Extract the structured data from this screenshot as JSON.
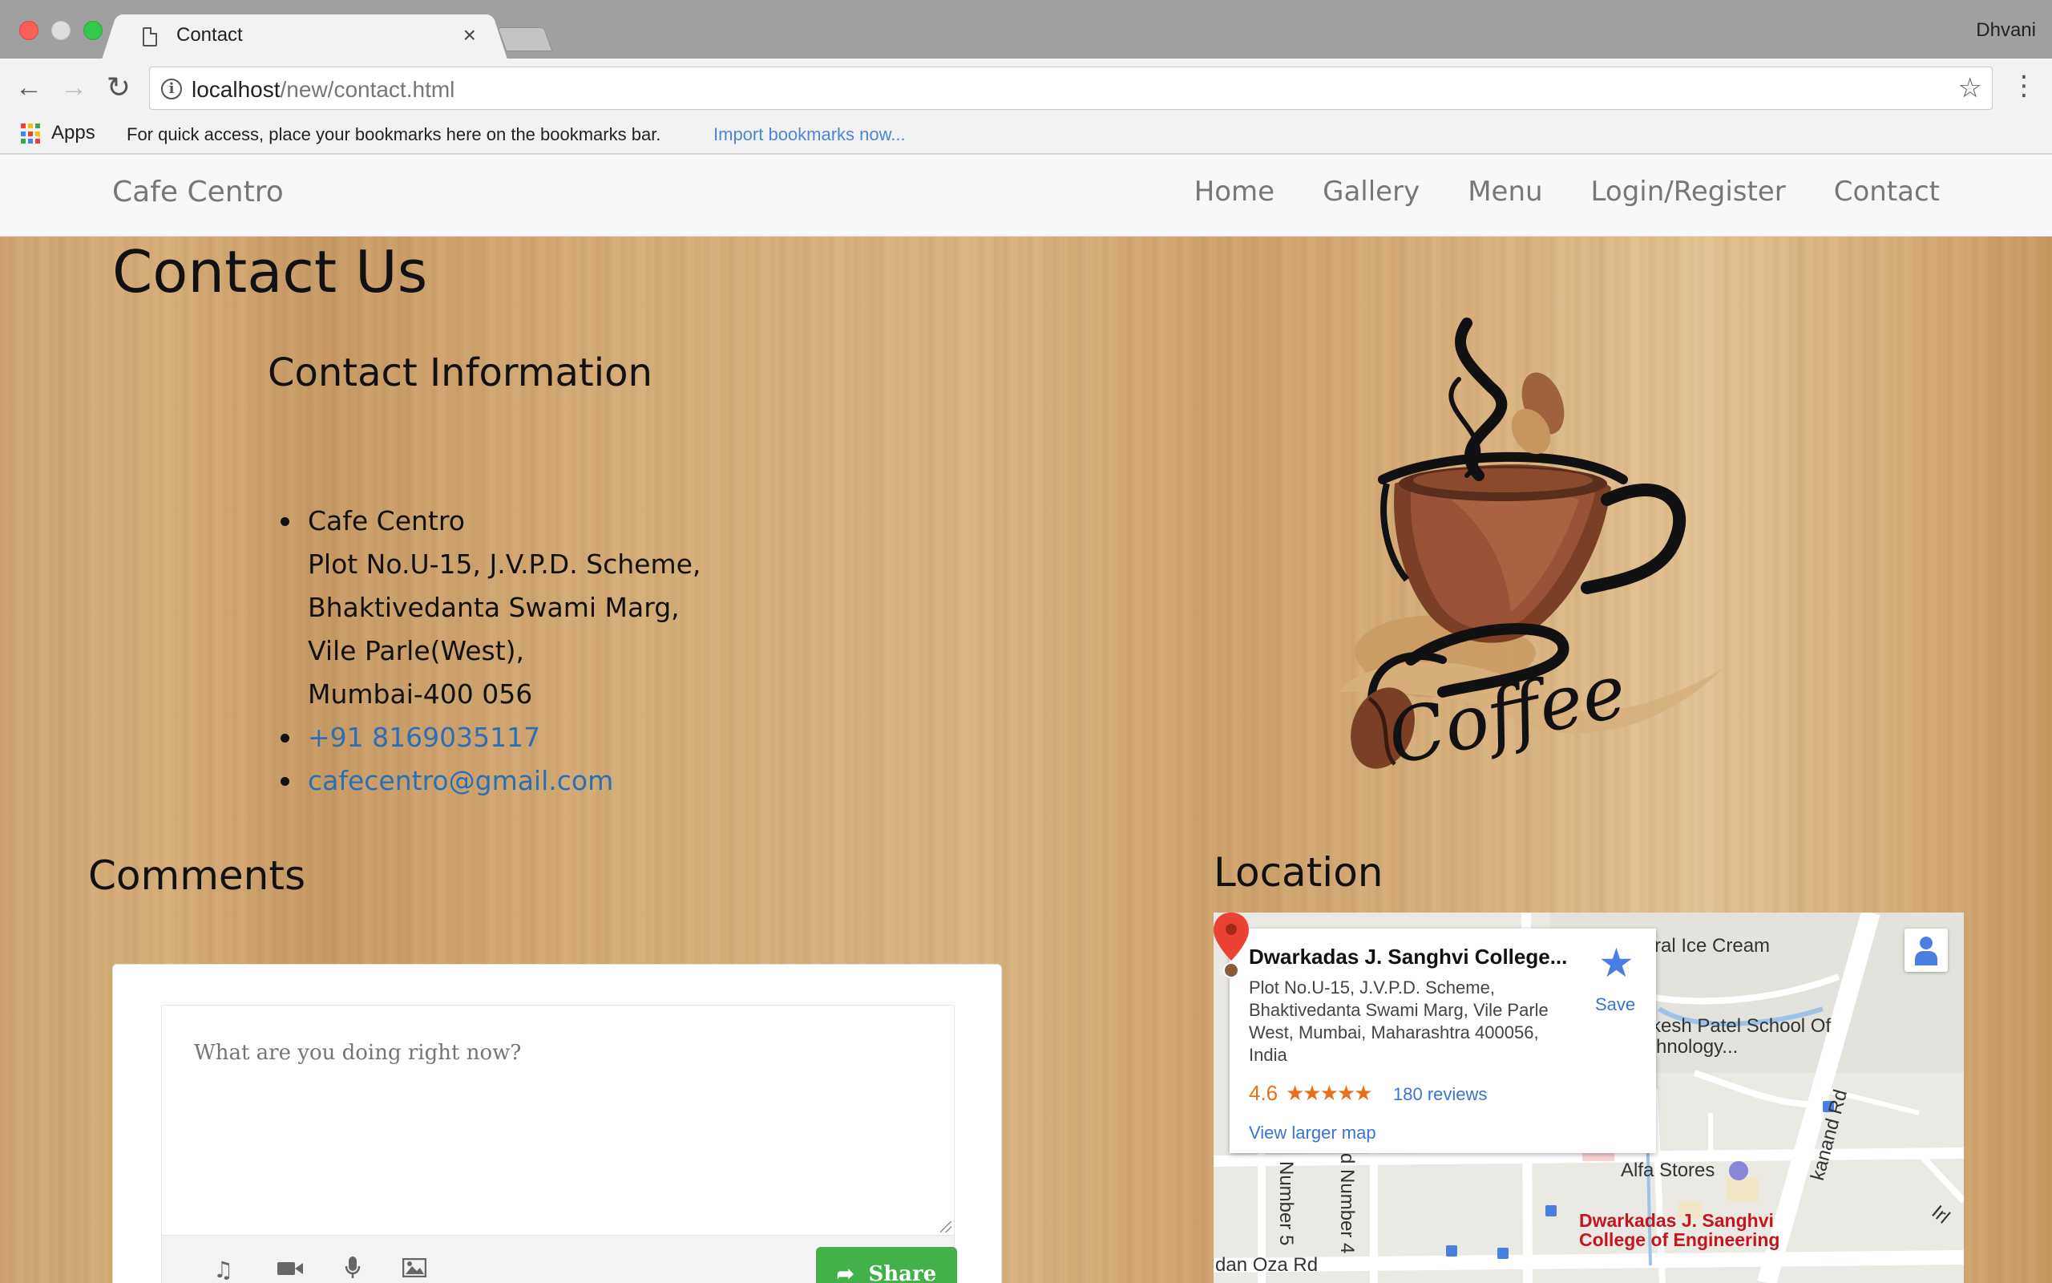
{
  "browser": {
    "tab_title": "Contact",
    "tab_close": "×",
    "profile_name": "Dhvani",
    "url_host": "localhost",
    "url_path": "/new/contact.html",
    "bookmarks": {
      "apps_label": "Apps",
      "hint": "For quick access, place your bookmarks here on the bookmarks bar.",
      "import_link": "Import bookmarks now..."
    }
  },
  "site": {
    "brand": "Cafe Centro",
    "nav": [
      "Home",
      "Gallery",
      "Menu",
      "Login/Register",
      "Contact"
    ]
  },
  "contact": {
    "heading": "Contact Us",
    "info_heading": "Contact Information",
    "address_lines": [
      "Cafe Centro",
      "Plot No.U-15, J.V.P.D. Scheme,",
      "Bhaktivedanta Swami Marg,",
      "Vile Parle(West),",
      "Mumbai-400 056"
    ],
    "phone": "+91 8169035117",
    "email": "cafecentro@gmail.com",
    "logo_text": "Coffee"
  },
  "comments": {
    "heading": "Comments",
    "placeholder": "What are you doing right now?",
    "share_label": "Share",
    "tools": [
      "music-icon",
      "video-icon",
      "mic-icon",
      "image-icon"
    ]
  },
  "location": {
    "heading": "Location",
    "card": {
      "name": "Dwarkadas J. Sanghvi College...",
      "address": "Plot No.U-15, J.V.P.D. Scheme, Bhaktivedanta Swami Marg, Vile Parle West, Mumbai, Maharashtra 400056, India",
      "rating": "4.6",
      "stars": "★★★★★",
      "reviews": "180 reviews",
      "larger_map": "View larger map",
      "save_label": "Save"
    },
    "map_labels": {
      "ice_cream": "ral Ice Cream",
      "school_1": "kesh Patel School Of",
      "school_2": "hnology...",
      "alfa": "Alfa Stores",
      "road_1": "Number 5",
      "road_2": "d Number 4",
      "road_3": "kanand Rd",
      "road_4": "dan Oza Rd",
      "road_5": "Irl",
      "pin_line1": "Dwarkadas J. Sanghvi",
      "pin_line2": "College of Engineering"
    }
  },
  "colors": {
    "link": "#2a6fb5",
    "share_green": "#43b049",
    "rating_orange": "#e7711b",
    "map_blue": "#3b73d1"
  }
}
